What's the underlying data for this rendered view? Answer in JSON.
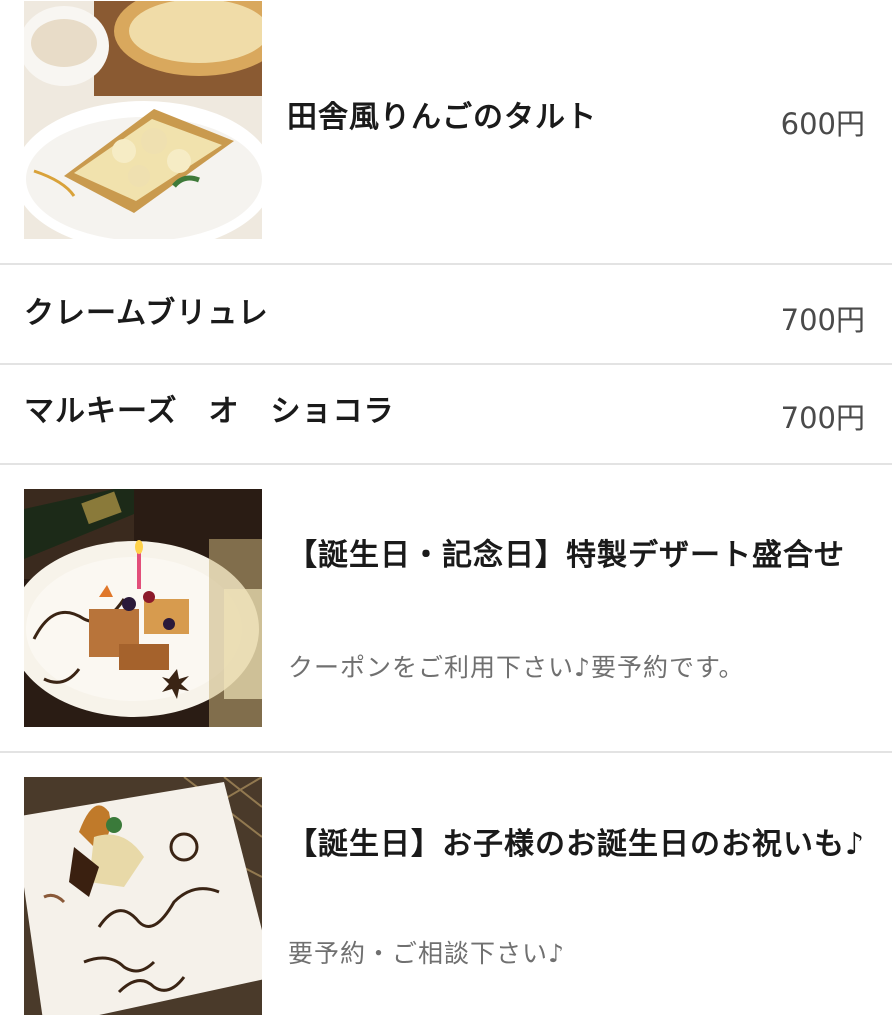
{
  "menu": {
    "items": [
      {
        "name": "田舎風りんごのタルト",
        "price": "600円",
        "image": "apple-tart-photo"
      },
      {
        "name": "クレームブリュレ",
        "price": "700円"
      },
      {
        "name": "マルキーズ　オ　ショコラ",
        "price": "700円"
      },
      {
        "name": "【誕生日・記念日】特製デザート盛合せ",
        "description": "クーポンをご利用下さい♪要予約です。",
        "image": "birthday-dessert-plate-photo"
      },
      {
        "name": "【誕生日】お子様のお誕生日のお祝いも♪",
        "description": "要予約・ご相談下さい♪",
        "image": "kids-birthday-plate-photo"
      }
    ]
  },
  "colors": {
    "divider": "#e3e3e3",
    "name_text": "#1a1a1a",
    "price_text": "#4a4a4a",
    "description_text": "#707070"
  }
}
